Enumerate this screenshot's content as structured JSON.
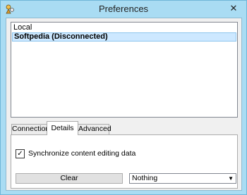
{
  "window": {
    "title": "Preferences",
    "close_glyph": "✕"
  },
  "server_list": {
    "items": [
      {
        "label": "Local",
        "selected": false
      },
      {
        "label": "Softpedia (Disconnected)",
        "selected": true
      }
    ]
  },
  "tabs": [
    {
      "label": "Connection",
      "active": false
    },
    {
      "label": "Details",
      "active": true
    },
    {
      "label": "Advanced",
      "active": false
    }
  ],
  "details": {
    "sync_checkbox": {
      "label": "Synchronize content editing data",
      "checked": true,
      "glyph": "✓"
    },
    "clear_label": "Clear",
    "dropdown": {
      "selected": "Nothing",
      "arrow": "▼"
    }
  },
  "icons": {
    "app": "app-icon",
    "close": "close-icon",
    "checkbox": "checkmark-icon",
    "dropdown": "chevron-down-icon"
  }
}
